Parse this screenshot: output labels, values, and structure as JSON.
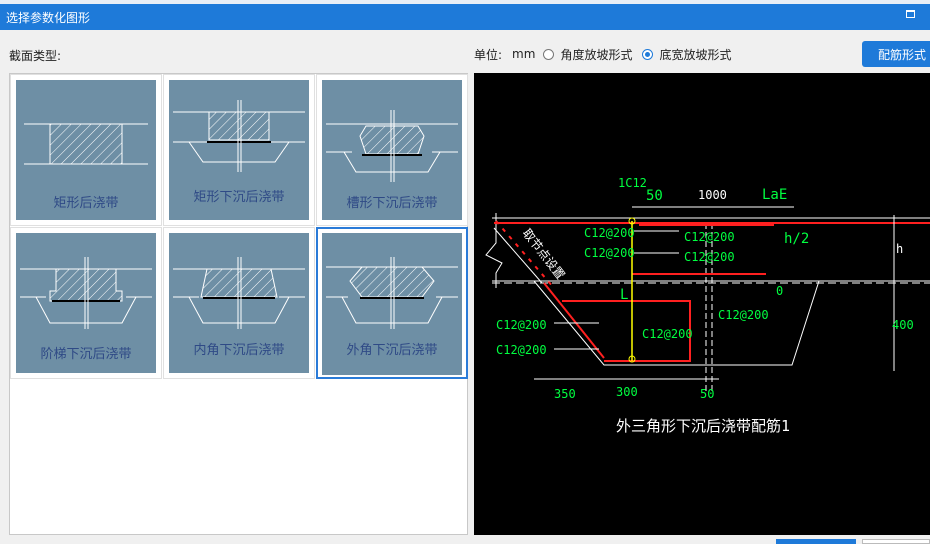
{
  "window": {
    "title": "选择参数化图形"
  },
  "section_label": "截面类型:",
  "unit": {
    "label": "单位:",
    "value": "mm",
    "options": [
      {
        "label": "角度放坡形式",
        "selected": false
      },
      {
        "label": "底宽放坡形式",
        "selected": true
      }
    ]
  },
  "rebar_button": "配筋形式",
  "shapes": [
    {
      "label": "矩形后浇带",
      "selected": false
    },
    {
      "label": "矩形下沉后浇带",
      "selected": false
    },
    {
      "label": "槽形下沉后浇带",
      "selected": false
    },
    {
      "label": "阶梯下沉后浇带",
      "selected": false
    },
    {
      "label": "内角下沉后浇带",
      "selected": false
    },
    {
      "label": "外角下沉后浇带",
      "selected": true
    }
  ],
  "preview": {
    "caption": "外三角形下沉后浇带配筋1",
    "labels": {
      "top_bar": "1C12",
      "dim_50_top": "50",
      "dim_1000": "1000",
      "lae": "LaE",
      "h_half": "h/2",
      "h": "h",
      "dim_400": "400",
      "zero": "0",
      "L": "L",
      "slope_note": "取节点设置",
      "c1": "C12@200",
      "c2": "C12@200",
      "c3": "C12@200",
      "c4": "C12@200",
      "c5": "C12@200",
      "c6": "C12@200",
      "c7": "C12@200",
      "c8": "C12@200",
      "dim_350": "350",
      "dim_300": "300",
      "dim_50_bottom": "50"
    }
  },
  "colors": {
    "title_bar": "#1e7ad9",
    "thumb_bg": "#6e8fa5",
    "thumb_caption": "#2f4a86",
    "rebar": "#ff2020",
    "label_green": "#00ff40",
    "yellow": "#ffff00"
  }
}
